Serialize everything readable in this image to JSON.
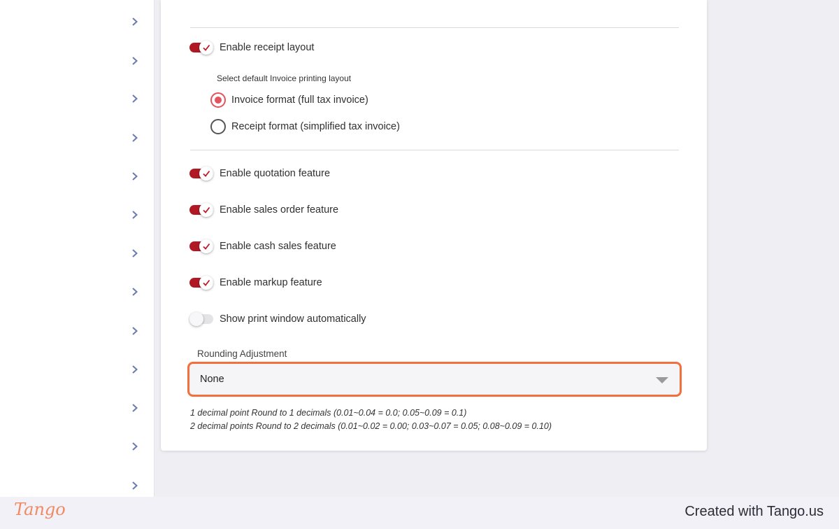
{
  "sidebar": {
    "chevron_icon": "chevron-right-icon",
    "chevron_color": "#6b7bb0",
    "items": [
      {
        "label": ""
      },
      {
        "label": ""
      },
      {
        "label": ""
      },
      {
        "label": ""
      },
      {
        "label": ""
      },
      {
        "label": ""
      },
      {
        "label": ""
      },
      {
        "label": ""
      },
      {
        "label": ""
      },
      {
        "label": ""
      },
      {
        "label": ""
      },
      {
        "label": ""
      },
      {
        "label": ""
      }
    ]
  },
  "settings": {
    "receipt_layout_toggle": {
      "label": "Enable receipt layout",
      "on": true
    },
    "printing_layout_caption": "Select default Invoice printing layout",
    "layout_options": [
      {
        "label": "Invoice format (full tax invoice)",
        "selected": true
      },
      {
        "label": "Receipt format (simplified tax invoice)",
        "selected": false
      }
    ],
    "feature_toggles": [
      {
        "label": "Enable quotation feature",
        "on": true
      },
      {
        "label": "Enable sales order feature",
        "on": true
      },
      {
        "label": "Enable cash sales feature",
        "on": true
      },
      {
        "label": "Enable markup feature",
        "on": true
      },
      {
        "label": "Show print window automatically",
        "on": false
      }
    ],
    "rounding": {
      "label": "Rounding Adjustment",
      "value": "None",
      "hints": [
        "1 decimal point Round to 1 decimals (0.01~0.04 = 0.0; 0.05~0.09 = 0.1)",
        "2 decimal points Round to 2 decimals (0.01~0.02 = 0.00; 0.03~0.07 = 0.05; 0.08~0.09 = 0.10)"
      ]
    }
  },
  "colors": {
    "toggle_on": "#b01924",
    "radio_selected": "#e4535f",
    "highlight_border": "#f36f3e"
  },
  "footer": {
    "logo_text": "Tango",
    "credit": "Created with Tango.us"
  }
}
